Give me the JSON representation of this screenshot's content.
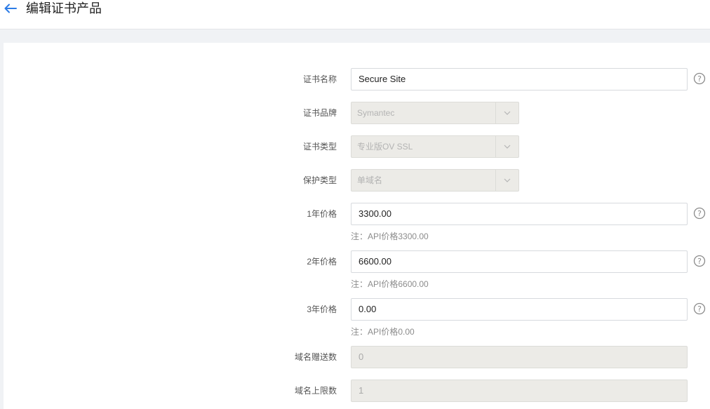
{
  "header": {
    "title": "编辑证书产品"
  },
  "form": {
    "cert_name": {
      "label": "证书名称",
      "value": "Secure Site"
    },
    "cert_brand": {
      "label": "证书品牌",
      "value": "Symantec"
    },
    "cert_type": {
      "label": "证书类型",
      "value": "专业版OV SSL"
    },
    "protect_type": {
      "label": "保护类型",
      "value": "单域名"
    },
    "price_1y": {
      "label": "1年价格",
      "value": "3300.00",
      "note": "注：API价格3300.00"
    },
    "price_2y": {
      "label": "2年价格",
      "value": "6600.00",
      "note": "注：API价格6600.00"
    },
    "price_3y": {
      "label": "3年价格",
      "value": "0.00",
      "note": "注：API价格0.00"
    },
    "domain_gift": {
      "label": "域名赠送数",
      "value": "0"
    },
    "domain_limit": {
      "label": "域名上限数",
      "value": "1"
    }
  },
  "colors": {
    "accent": "#2d7ce6",
    "disabled_bg": "#ecebe7"
  }
}
